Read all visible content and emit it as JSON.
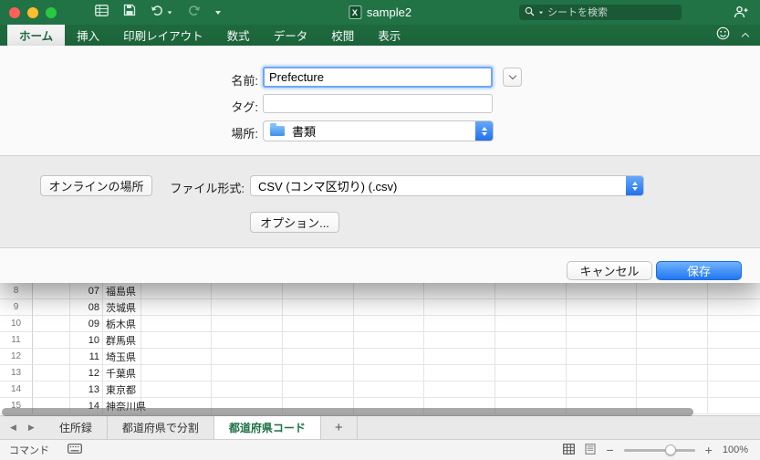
{
  "titlebar": {
    "title": "sample2",
    "doc_icon_letter": "X",
    "search_placeholder": "シートを検索"
  },
  "ribbon": {
    "tabs": [
      {
        "label": "ホーム",
        "active": true
      },
      {
        "label": "挿入",
        "active": false
      },
      {
        "label": "印刷レイアウト",
        "active": false
      },
      {
        "label": "数式",
        "active": false
      },
      {
        "label": "データ",
        "active": false
      },
      {
        "label": "校閲",
        "active": false
      },
      {
        "label": "表示",
        "active": false
      }
    ]
  },
  "dialog": {
    "name": {
      "label": "名前:",
      "value": "Prefecture"
    },
    "tags": {
      "label": "タグ:",
      "value": ""
    },
    "where": {
      "label": "場所:",
      "value": "書類"
    },
    "online_locations_button": "オンラインの場所",
    "file_format": {
      "label": "ファイル形式:",
      "value": "CSV (コンマ区切り) (.csv)"
    },
    "options_button": "オプション...",
    "cancel_button": "キャンセル",
    "save_button": "保存"
  },
  "grid": {
    "rows": [
      {
        "num": "8",
        "code": "07",
        "name": "福島県"
      },
      {
        "num": "9",
        "code": "08",
        "name": "茨城県"
      },
      {
        "num": "10",
        "code": "09",
        "name": "栃木県"
      },
      {
        "num": "11",
        "code": "10",
        "name": "群馬県"
      },
      {
        "num": "12",
        "code": "11",
        "name": "埼玉県"
      },
      {
        "num": "13",
        "code": "12",
        "name": "千葉県"
      },
      {
        "num": "14",
        "code": "13",
        "name": "東京都"
      },
      {
        "num": "15",
        "code": "14",
        "name": "神奈川県"
      }
    ]
  },
  "sheet_tabs": {
    "prev_arrow": "◀",
    "next_arrow": "▶",
    "tabs": [
      {
        "label": "住所録",
        "active": false
      },
      {
        "label": "都道府県で分割",
        "active": false
      },
      {
        "label": "都道府県コード",
        "active": true
      }
    ],
    "add_label": "+"
  },
  "statusbar": {
    "mode": "コマンド",
    "zoom_out": "−",
    "zoom_in": "+",
    "zoom_percent": "100%"
  },
  "colors": {
    "excel_green": "#217346",
    "ribbon_green": "#1e6a3e",
    "accent_blue": "#2176f2",
    "active_sheet_tab_text": "#1e7145"
  }
}
